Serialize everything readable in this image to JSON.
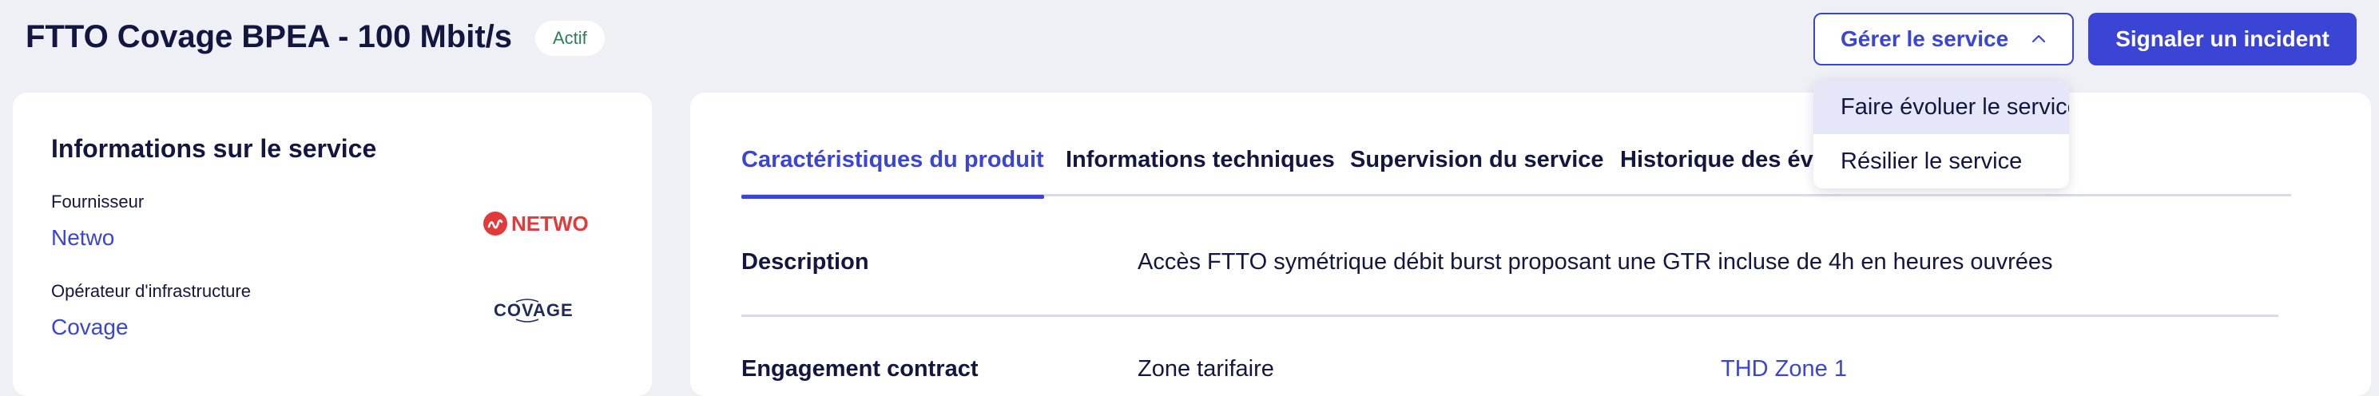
{
  "header": {
    "title": "FTTO Covage BPEA - 100 Mbit/s",
    "status": "Actif",
    "manage_label": "Gérer le service",
    "incident_label": "Signaler un incident"
  },
  "manage_menu": {
    "items": [
      "Faire évoluer le service",
      "Résilier le service"
    ]
  },
  "service_info": {
    "title": "Informations sur le service",
    "provider_label": "Fournisseur",
    "provider_value": "Netwo",
    "provider_logo_text": "NETWO",
    "operator_label": "Opérateur d'infrastructure",
    "operator_value": "Covage",
    "operator_logo_text": "COVAGE"
  },
  "tabs": [
    "Caractéristiques du produit",
    "Informations techniques",
    "Supervision du service",
    "Historique des év"
  ],
  "details": {
    "description_label": "Description",
    "description_value": "Accès FTTO symétrique débit burst proposant une GTR incluse de 4h en heures ouvrées",
    "row2_label": "Engagement contract",
    "row2_value": "Zone tarifaire",
    "row2_link": "THD Zone 1"
  },
  "colors": {
    "accent": "#3a45d6",
    "text": "#121640",
    "status": "#2e7d55",
    "background": "#eef0f5",
    "netwo_red": "#e23a3a"
  }
}
